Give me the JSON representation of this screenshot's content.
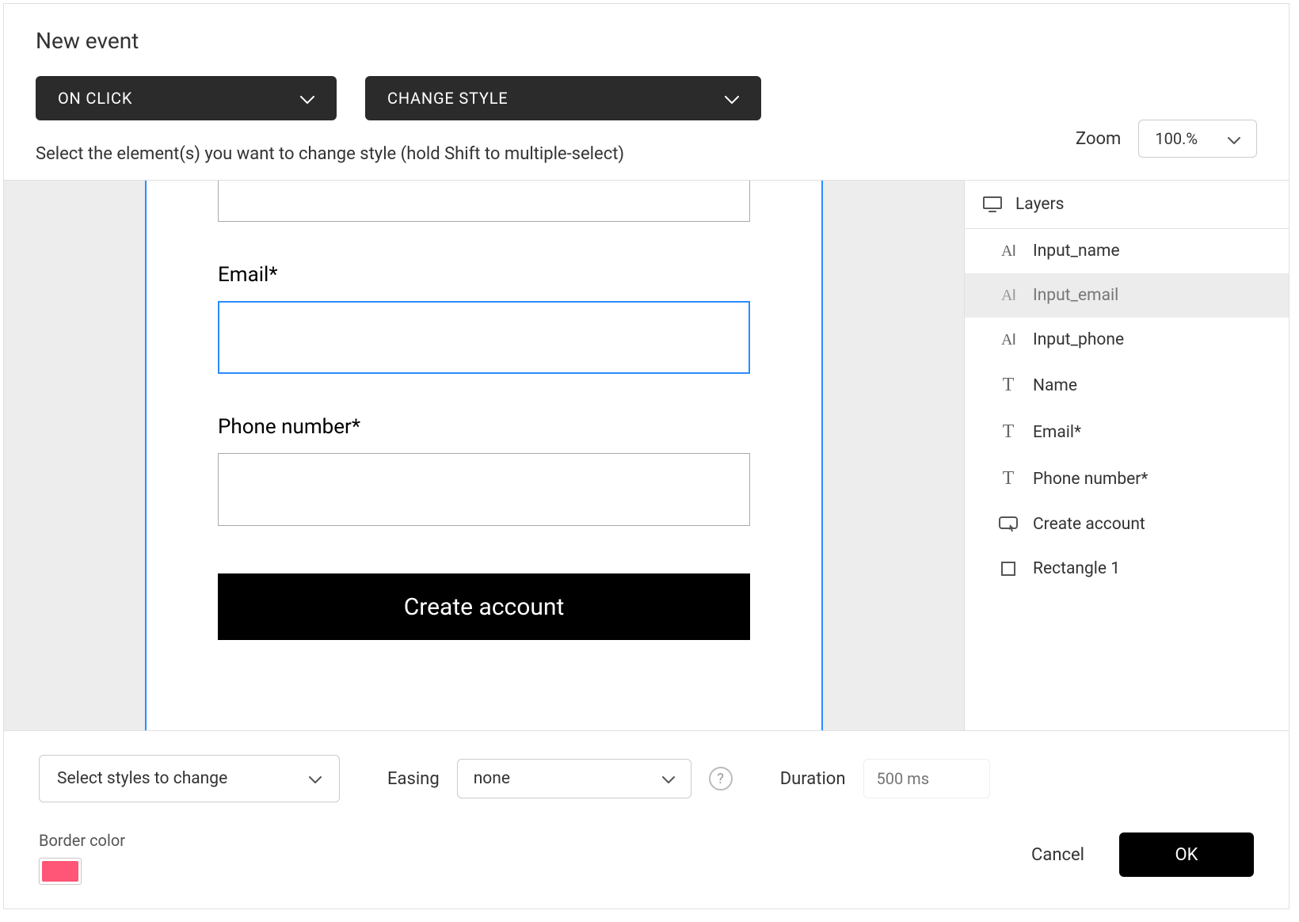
{
  "header": {
    "title": "New event",
    "trigger_label": "ON CLICK",
    "action_label": "CHANGE STYLE",
    "instruction": "Select the element(s) you want to change style (hold Shift to multiple-select)",
    "zoom_label": "Zoom",
    "zoom_value": "100.%"
  },
  "canvas": {
    "labels": {
      "email": "Email*",
      "phone": "Phone number*"
    },
    "button": "Create account"
  },
  "layers": {
    "title": "Layers",
    "items": [
      {
        "name": "Input_name",
        "icon": "text-input",
        "selected": false
      },
      {
        "name": "Input_email",
        "icon": "text-input",
        "selected": true
      },
      {
        "name": "Input_phone",
        "icon": "text-input",
        "selected": false
      },
      {
        "name": "Name",
        "icon": "text-static",
        "selected": false
      },
      {
        "name": "Email*",
        "icon": "text-static",
        "selected": false
      },
      {
        "name": "Phone number*",
        "icon": "text-static",
        "selected": false
      },
      {
        "name": "Create account",
        "icon": "button",
        "selected": false
      },
      {
        "name": "Rectangle 1",
        "icon": "rect",
        "selected": false
      }
    ]
  },
  "bottom": {
    "styles_select": "Select styles to change",
    "easing_label": "Easing",
    "easing_value": "none",
    "duration_label": "Duration",
    "duration_placeholder": "500 ms",
    "border_color_label": "Border color",
    "border_color": "#ff5577",
    "cancel": "Cancel",
    "ok": "OK"
  }
}
